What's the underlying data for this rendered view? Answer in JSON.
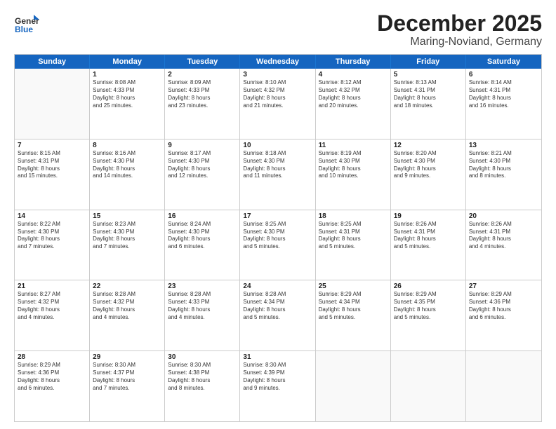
{
  "logo": {
    "general": "General",
    "blue": "Blue"
  },
  "title": {
    "month": "December 2025",
    "location": "Maring-Noviand, Germany"
  },
  "header_days": [
    "Sunday",
    "Monday",
    "Tuesday",
    "Wednesday",
    "Thursday",
    "Friday",
    "Saturday"
  ],
  "weeks": [
    [
      {
        "day": "",
        "info": ""
      },
      {
        "day": "1",
        "info": "Sunrise: 8:08 AM\nSunset: 4:33 PM\nDaylight: 8 hours\nand 25 minutes."
      },
      {
        "day": "2",
        "info": "Sunrise: 8:09 AM\nSunset: 4:33 PM\nDaylight: 8 hours\nand 23 minutes."
      },
      {
        "day": "3",
        "info": "Sunrise: 8:10 AM\nSunset: 4:32 PM\nDaylight: 8 hours\nand 21 minutes."
      },
      {
        "day": "4",
        "info": "Sunrise: 8:12 AM\nSunset: 4:32 PM\nDaylight: 8 hours\nand 20 minutes."
      },
      {
        "day": "5",
        "info": "Sunrise: 8:13 AM\nSunset: 4:31 PM\nDaylight: 8 hours\nand 18 minutes."
      },
      {
        "day": "6",
        "info": "Sunrise: 8:14 AM\nSunset: 4:31 PM\nDaylight: 8 hours\nand 16 minutes."
      }
    ],
    [
      {
        "day": "7",
        "info": "Sunrise: 8:15 AM\nSunset: 4:31 PM\nDaylight: 8 hours\nand 15 minutes."
      },
      {
        "day": "8",
        "info": "Sunrise: 8:16 AM\nSunset: 4:30 PM\nDaylight: 8 hours\nand 14 minutes."
      },
      {
        "day": "9",
        "info": "Sunrise: 8:17 AM\nSunset: 4:30 PM\nDaylight: 8 hours\nand 12 minutes."
      },
      {
        "day": "10",
        "info": "Sunrise: 8:18 AM\nSunset: 4:30 PM\nDaylight: 8 hours\nand 11 minutes."
      },
      {
        "day": "11",
        "info": "Sunrise: 8:19 AM\nSunset: 4:30 PM\nDaylight: 8 hours\nand 10 minutes."
      },
      {
        "day": "12",
        "info": "Sunrise: 8:20 AM\nSunset: 4:30 PM\nDaylight: 8 hours\nand 9 minutes."
      },
      {
        "day": "13",
        "info": "Sunrise: 8:21 AM\nSunset: 4:30 PM\nDaylight: 8 hours\nand 8 minutes."
      }
    ],
    [
      {
        "day": "14",
        "info": "Sunrise: 8:22 AM\nSunset: 4:30 PM\nDaylight: 8 hours\nand 7 minutes."
      },
      {
        "day": "15",
        "info": "Sunrise: 8:23 AM\nSunset: 4:30 PM\nDaylight: 8 hours\nand 7 minutes."
      },
      {
        "day": "16",
        "info": "Sunrise: 8:24 AM\nSunset: 4:30 PM\nDaylight: 8 hours\nand 6 minutes."
      },
      {
        "day": "17",
        "info": "Sunrise: 8:25 AM\nSunset: 4:30 PM\nDaylight: 8 hours\nand 5 minutes."
      },
      {
        "day": "18",
        "info": "Sunrise: 8:25 AM\nSunset: 4:31 PM\nDaylight: 8 hours\nand 5 minutes."
      },
      {
        "day": "19",
        "info": "Sunrise: 8:26 AM\nSunset: 4:31 PM\nDaylight: 8 hours\nand 5 minutes."
      },
      {
        "day": "20",
        "info": "Sunrise: 8:26 AM\nSunset: 4:31 PM\nDaylight: 8 hours\nand 4 minutes."
      }
    ],
    [
      {
        "day": "21",
        "info": "Sunrise: 8:27 AM\nSunset: 4:32 PM\nDaylight: 8 hours\nand 4 minutes."
      },
      {
        "day": "22",
        "info": "Sunrise: 8:28 AM\nSunset: 4:32 PM\nDaylight: 8 hours\nand 4 minutes."
      },
      {
        "day": "23",
        "info": "Sunrise: 8:28 AM\nSunset: 4:33 PM\nDaylight: 8 hours\nand 4 minutes."
      },
      {
        "day": "24",
        "info": "Sunrise: 8:28 AM\nSunset: 4:34 PM\nDaylight: 8 hours\nand 5 minutes."
      },
      {
        "day": "25",
        "info": "Sunrise: 8:29 AM\nSunset: 4:34 PM\nDaylight: 8 hours\nand 5 minutes."
      },
      {
        "day": "26",
        "info": "Sunrise: 8:29 AM\nSunset: 4:35 PM\nDaylight: 8 hours\nand 5 minutes."
      },
      {
        "day": "27",
        "info": "Sunrise: 8:29 AM\nSunset: 4:36 PM\nDaylight: 8 hours\nand 6 minutes."
      }
    ],
    [
      {
        "day": "28",
        "info": "Sunrise: 8:29 AM\nSunset: 4:36 PM\nDaylight: 8 hours\nand 6 minutes."
      },
      {
        "day": "29",
        "info": "Sunrise: 8:30 AM\nSunset: 4:37 PM\nDaylight: 8 hours\nand 7 minutes."
      },
      {
        "day": "30",
        "info": "Sunrise: 8:30 AM\nSunset: 4:38 PM\nDaylight: 8 hours\nand 8 minutes."
      },
      {
        "day": "31",
        "info": "Sunrise: 8:30 AM\nSunset: 4:39 PM\nDaylight: 8 hours\nand 9 minutes."
      },
      {
        "day": "",
        "info": ""
      },
      {
        "day": "",
        "info": ""
      },
      {
        "day": "",
        "info": ""
      }
    ]
  ]
}
